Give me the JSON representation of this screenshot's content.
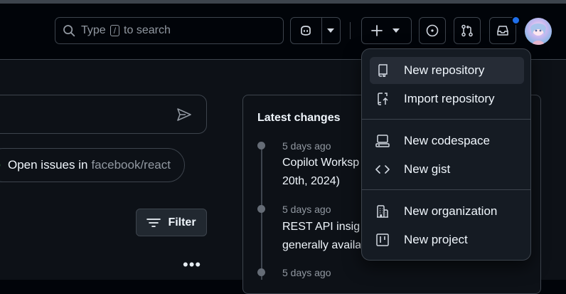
{
  "search": {
    "type_label": "Type",
    "key": "/",
    "rest_label": "to search"
  },
  "chat": {
    "suggestion_label": "Open issues in",
    "suggestion_repo": "facebook/react"
  },
  "filter": {
    "label": "Filter"
  },
  "changes": {
    "title": "Latest changes",
    "items": [
      {
        "date": "5 days ago",
        "lines": [
          "Copilot Worksp",
          "20th, 2024)"
        ]
      },
      {
        "date": "5 days ago",
        "lines": [
          "REST API insigh",
          "generally availa"
        ]
      },
      {
        "date": "5 days ago",
        "lines": []
      }
    ]
  },
  "menu": {
    "items": [
      {
        "label": "New repository",
        "icon": "repo-icon"
      },
      {
        "label": "Import repository",
        "icon": "repo-push-icon"
      },
      {
        "label": "New codespace",
        "icon": "codespace-icon"
      },
      {
        "label": "New gist",
        "icon": "code-icon"
      },
      {
        "label": "New organization",
        "icon": "organization-icon"
      },
      {
        "label": "New project",
        "icon": "table-icon"
      }
    ]
  },
  "colors": {
    "accent": "#1f6feb",
    "menu_bg": "#151b23",
    "border": "#3d444d"
  }
}
